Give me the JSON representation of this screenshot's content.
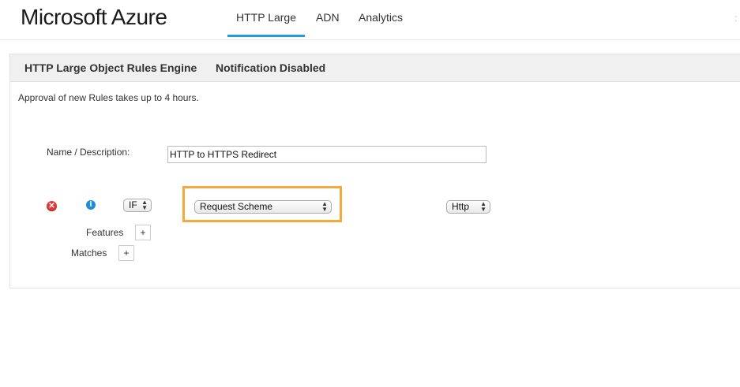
{
  "header": {
    "brand": "Microsoft Azure",
    "tabs": [
      {
        "label": "HTTP Large",
        "active": true
      },
      {
        "label": "ADN",
        "active": false
      },
      {
        "label": "Analytics",
        "active": false
      }
    ],
    "accent_color": "#1fa0d8"
  },
  "panel": {
    "title": "HTTP Large Object Rules Engine",
    "status": "Notification Disabled",
    "notice": "Approval of new Rules takes up to 4 hours.",
    "name_label": "Name / Description:",
    "name_value": "HTTP to HTTPS Redirect",
    "condition": {
      "if_select": "IF",
      "match_select": "Request Scheme",
      "value_select": "Http",
      "highlight_color": "#f5a93a"
    },
    "features_label": "Features",
    "matches_label": "Matches",
    "add_symbol": "+",
    "delete_icon": "delete-icon",
    "info_icon": "info-icon"
  }
}
